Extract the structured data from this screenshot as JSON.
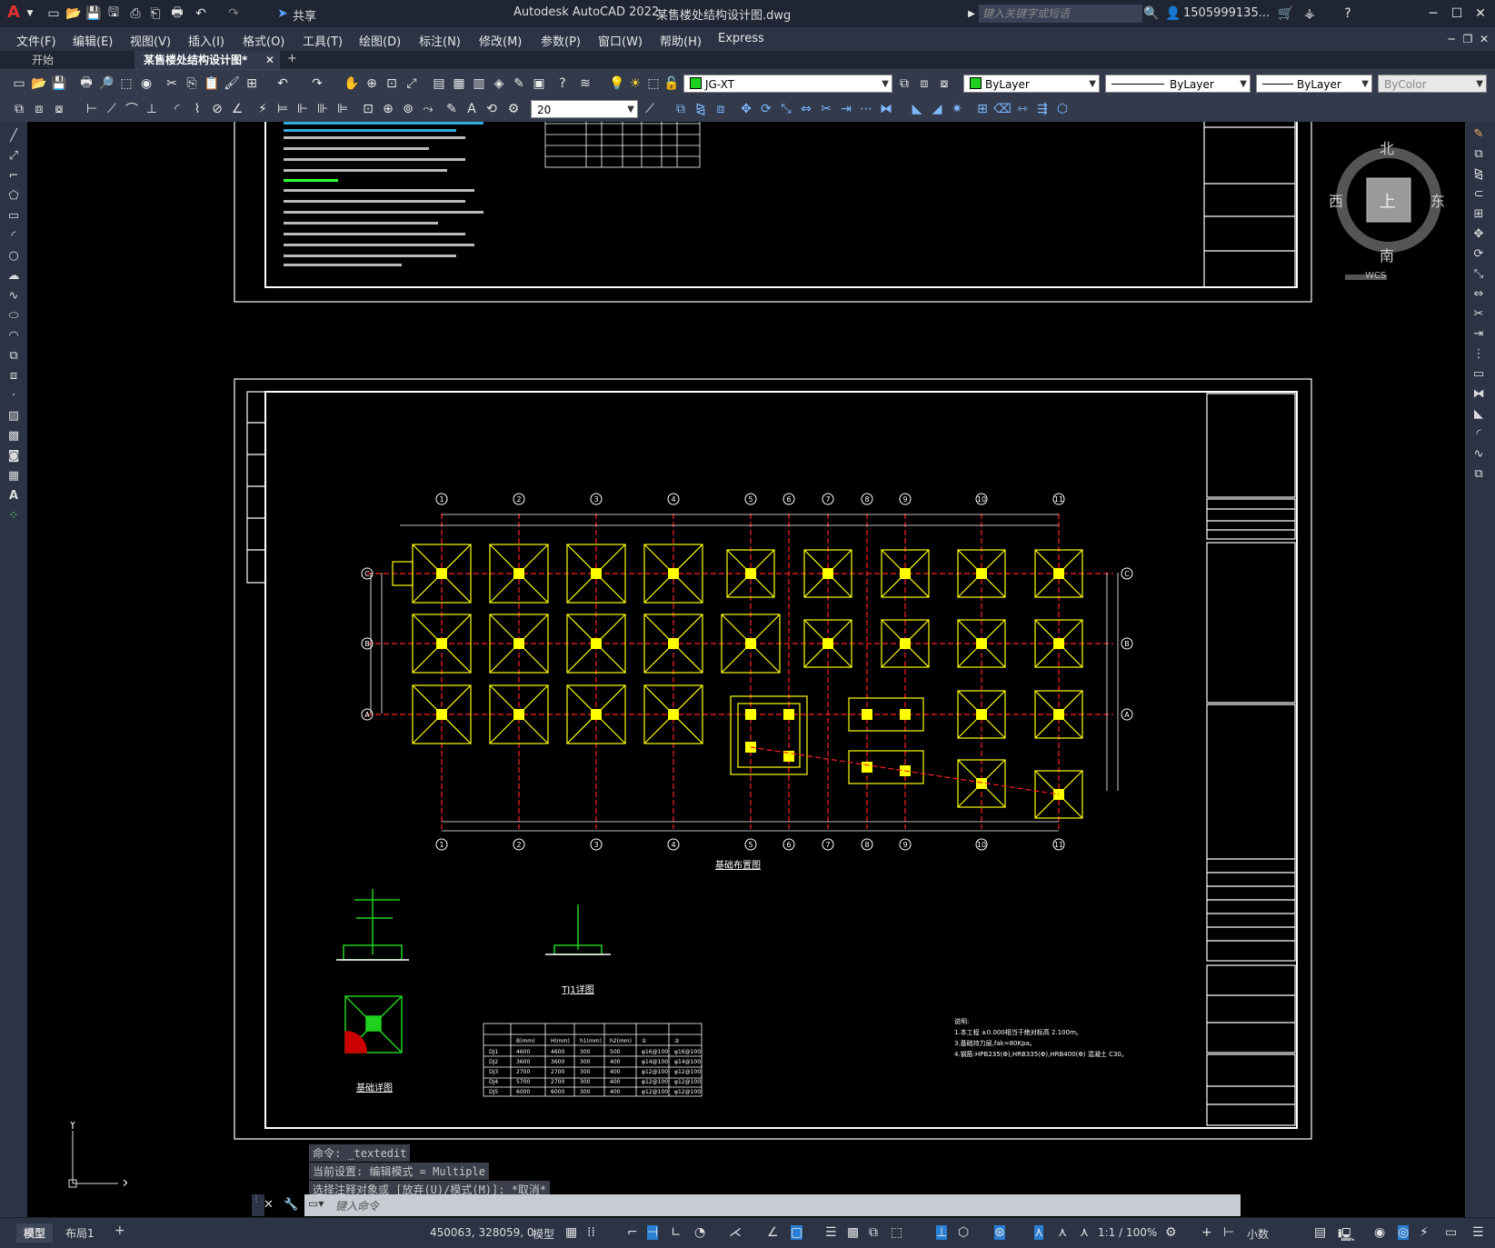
{
  "app": {
    "title": "Autodesk AutoCAD 2022",
    "document": "某售楼处结构设计图.dwg",
    "share_label": "共享",
    "search_placeholder": "键入关键字或短语",
    "user": "1505999135...",
    "logo": "A"
  },
  "menu": [
    "文件(F)",
    "编辑(E)",
    "视图(V)",
    "插入(I)",
    "格式(O)",
    "工具(T)",
    "绘图(D)",
    "标注(N)",
    "修改(M)",
    "参数(P)",
    "窗口(W)",
    "帮助(H)",
    "Express"
  ],
  "tabs": [
    {
      "label": "开始",
      "active": false
    },
    {
      "label": "某售楼处结构设计图*",
      "active": true
    }
  ],
  "toolbar": {
    "layer": "JG-XT",
    "color": "ByLayer",
    "linetype": "ByLayer",
    "lineweight": "ByLayer",
    "plotstyle": "ByColor",
    "dimstyle_value": "20"
  },
  "viewcube": {
    "north": "北",
    "south": "南",
    "east": "东",
    "west": "西",
    "top": "上",
    "wcs": "WCS"
  },
  "drawing": {
    "plan_title": "基础布置图",
    "detail_title": "基础详图",
    "tj_title": "TJ1详图",
    "axes_numbers": [
      "1",
      "2",
      "3",
      "4",
      "5",
      "6",
      "7",
      "8",
      "9",
      "10",
      "11"
    ],
    "axes_letters": [
      "C",
      "B",
      "A"
    ],
    "table_rows": [
      [
        "DJ1",
        "4600",
        "4600",
        "300",
        "500",
        "φ16@100",
        "φ16@100"
      ],
      [
        "DJ2",
        "3600",
        "3600",
        "300",
        "400",
        "φ14@100",
        "φ14@100"
      ],
      [
        "DJ3",
        "2700",
        "2700",
        "300",
        "400",
        "φ12@100",
        "φ12@100"
      ],
      [
        "DJ4",
        "5700",
        "2700",
        "300",
        "400",
        "φ12@100",
        "φ12@100"
      ],
      [
        "DJ5",
        "6000",
        "6000",
        "300",
        "400",
        "φ12@100",
        "φ12@100"
      ]
    ],
    "table_headers": [
      "B(mm)",
      "H(mm)",
      "h1(mm)",
      "h2(mm)",
      "①",
      "②"
    ],
    "notes": [
      "说明:",
      "1.本工程 ±0.000相当于绝对标高 2.100m。",
      "3.基础持力层,fak=80Kpa。",
      "4.钢筋:HPB235(Φ),HRB335(Φ),HRB400(Φ) 混凝土 C30。"
    ]
  },
  "command": {
    "history": [
      "命令:  _textedit",
      "当前设置: 编辑模式 = Multiple",
      "选择注释对象或 [放弃(U)/模式(M)]: *取消*"
    ],
    "placeholder": "键入命令"
  },
  "status": {
    "layout_tabs": [
      "模型",
      "布局1"
    ],
    "coords": "450063, 328059, 0",
    "model_label": "模型",
    "scale": "1:1 / 100%",
    "units": "小数"
  },
  "colors": {
    "accent_blue": "#2a7fd4",
    "footing_yellow": "#ffff00",
    "axis_red": "#ff2020"
  }
}
